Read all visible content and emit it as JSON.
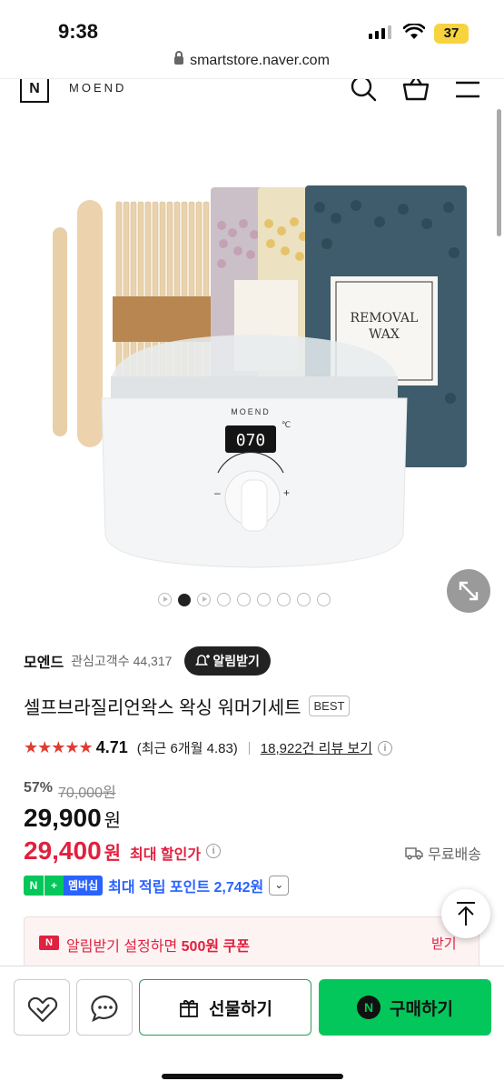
{
  "status": {
    "time": "9:38",
    "battery": "37"
  },
  "browser": {
    "url": "smartstore.naver.com"
  },
  "header": {
    "logo": "N",
    "brand": "MOEND"
  },
  "product_image": {
    "display_readout": "070",
    "unit": "℃",
    "pack_label_line1": "REMOVAL",
    "pack_label_line2": "WAX",
    "warmer_brand": "MOEND"
  },
  "gallery": {
    "dot_count": 9,
    "active_index": 1
  },
  "store": {
    "name": "모엔드",
    "followers_label": "관심고객수",
    "followers_count": "44,317",
    "alarm_label": "알림받기"
  },
  "product": {
    "title": "셀프브라질리언왁스 왁싱 워머기세트",
    "badge": "BEST"
  },
  "rating": {
    "stars": "★★★★★",
    "value": "4.71",
    "recent": "(최근 6개월 4.83)",
    "reviews": "18,922건 리뷰 보기",
    "info": "i"
  },
  "price": {
    "discount_pct": "57%",
    "original": "70,000원",
    "sale": "29,900",
    "won": "원",
    "best": "29,400",
    "best_won": "원",
    "best_label": "최대 할인가",
    "shipping": "무료배송"
  },
  "points": {
    "n": "N",
    "plus": "+",
    "member": "멤버십",
    "text": "최대 적립 포인트 2,742원"
  },
  "coupon": {
    "badge": "N",
    "prefix": "알림받기 설정하면 ",
    "amount": "500원 쿠폰",
    "action": "받기"
  },
  "actions": {
    "gift": "선물하기",
    "buy": "구매하기",
    "buy_icon": "N"
  }
}
